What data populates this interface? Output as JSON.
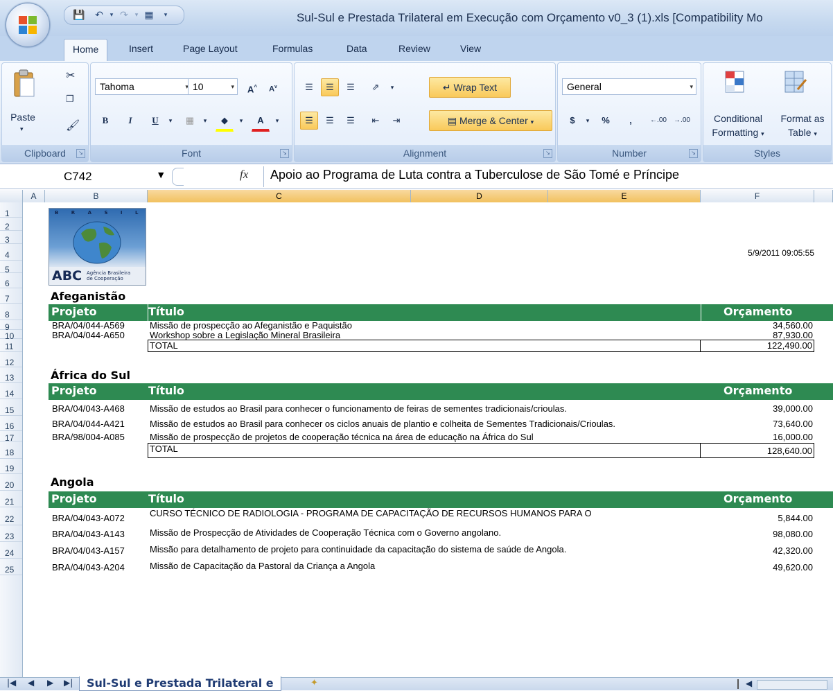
{
  "window": {
    "title": "Sul-Sul e Prestada Trilateral em Execução com Orçamento v0_3 (1).xls  [Compatibility Mo"
  },
  "tabs": [
    "Home",
    "Insert",
    "Page Layout",
    "Formulas",
    "Data",
    "Review",
    "View"
  ],
  "ribbon": {
    "clipboard": {
      "label": "Clipboard",
      "paste": "Paste"
    },
    "font": {
      "label": "Font",
      "family": "Tahoma",
      "size": "10",
      "bold": "B",
      "italic": "I",
      "underline": "U"
    },
    "alignment": {
      "label": "Alignment",
      "wrap": "Wrap Text",
      "merge": "Merge & Center"
    },
    "number": {
      "label": "Number",
      "format": "General",
      "currency": "$",
      "percent": "%",
      "comma": ",",
      "inc_dec": ".00",
      "dec_dec": ".00"
    },
    "styles": {
      "label": "Styles",
      "conditional_1": "Conditional",
      "conditional_2": "Formatting",
      "format_as_1": "Format as",
      "format_as_2": "Table"
    }
  },
  "formula_bar": {
    "name_box": "C742",
    "fx": "fx",
    "formula": "Apoio ao Programa de Luta contra a Tuberculose de São Tomé e Príncipe"
  },
  "columns": [
    "A",
    "B",
    "C",
    "D",
    "E",
    "F"
  ],
  "rows": [
    "1",
    "2",
    "3",
    "4",
    "5",
    "6",
    "7",
    "8",
    "9",
    "10",
    "11",
    "12",
    "13",
    "14",
    "15",
    "16",
    "17",
    "18",
    "19",
    "20",
    "21",
    "22",
    "23",
    "24",
    "25"
  ],
  "logo": {
    "top": "B R A S I L",
    "abbr": "ABC",
    "name_1": "Agência Brasileira",
    "name_2": "de Cooperação"
  },
  "timestamp": "5/9/2011 09:05:55",
  "headers": {
    "projeto": "Projeto",
    "titulo": "Título",
    "orcamento": "Orçamento"
  },
  "total_label": "TOTAL",
  "sections": [
    {
      "country": "Afeganistão",
      "items": [
        {
          "project": "BRA/04/044-A569",
          "title": "Missão de prospecção ao Afeganistão e Paquistão",
          "amount": "34,560.00"
        },
        {
          "project": "BRA/04/044-A650",
          "title": "Workshop sobre a Legislação Mineral Brasileira",
          "amount": "87,930.00"
        }
      ],
      "total": "122,490.00"
    },
    {
      "country": "África do Sul",
      "items": [
        {
          "project": "BRA/04/043-A468",
          "title": "Missão de estudos ao Brasil para conhecer o funcionamento de feiras de sementes tradicionais/crioulas.",
          "amount": "39,000.00"
        },
        {
          "project": "BRA/04/044-A421",
          "title": "Missão de estudos ao Brasil para conhecer os ciclos anuais de plantio e colheita de Sementes Tradicionais/Crioulas.",
          "amount": "73,640.00"
        },
        {
          "project": "BRA/98/004-A085",
          "title": "Missão de prospecção de projetos de cooperação técnica na área de educação na África do Sul",
          "amount": "16,000.00"
        }
      ],
      "total": "128,640.00"
    },
    {
      "country": "Angola",
      "items": [
        {
          "project": "BRA/04/043-A072",
          "title": "CURSO TÉCNICO DE RADIOLOGIA - PROGRAMA DE CAPACITAÇÃO DE RECURSOS HUMANOS PARA O",
          "amount": "5,844.00"
        },
        {
          "project": "BRA/04/043-A143",
          "title": "Missão de Prospecção de Atividades de Cooperação Técnica com o Governo angolano.",
          "amount": "98,080.00"
        },
        {
          "project": "BRA/04/043-A157",
          "title": "Missão para detalhamento de projeto para continuidade da capacitação do sistema de saúde de Angola.",
          "amount": "42,320.00"
        },
        {
          "project": "BRA/04/043-A204",
          "title": "Missão de Capacitação da Pastoral da Criança a Angola",
          "amount": "49,620.00"
        }
      ]
    }
  ],
  "sheet_tab": "Sul-Sul e Prestada Trilateral e",
  "colors": {
    "header_green": "#2e8a52",
    "ribbon_blue": "#bfd4ee",
    "selected_header": "#f1c15f"
  }
}
